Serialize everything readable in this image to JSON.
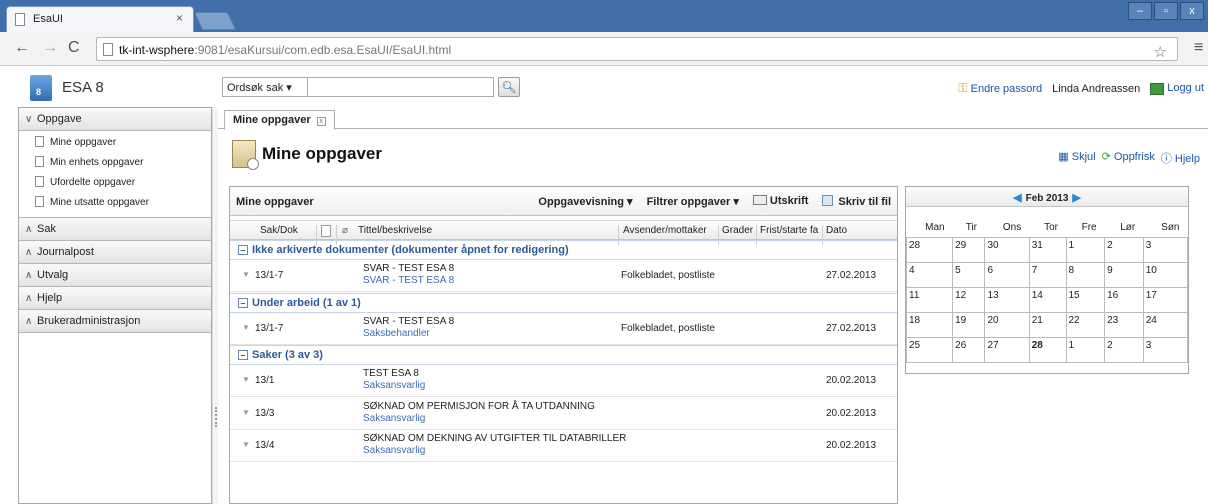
{
  "browser": {
    "tab_title": "EsaUI",
    "tab_close": "×",
    "url_host": "tk-int-wsphere",
    "url_rest": ":9081/esaKursui/com.edb.esa.EsaUI/EsaUI.html",
    "window_buttons": [
      "–",
      "▫",
      "x"
    ]
  },
  "app": {
    "name": "ESA 8",
    "logo_badge": "8",
    "search_mode": "Ordsøk sak ▾",
    "search_placeholder": "",
    "change_password": "Endre passord",
    "user_name": "Linda Andreassen",
    "logout": "Logg ut"
  },
  "sidebar": {
    "sections": [
      {
        "label": "Oppgave",
        "expanded": true,
        "items": [
          "Mine oppgaver",
          "Min enhets oppgaver",
          "Ufordelte oppgaver",
          "Mine utsatte oppgaver"
        ]
      },
      {
        "label": "Sak",
        "expanded": false
      },
      {
        "label": "Journalpost",
        "expanded": false
      },
      {
        "label": "Utvalg",
        "expanded": false
      },
      {
        "label": "Hjelp",
        "expanded": false
      },
      {
        "label": "Brukeradministrasjon",
        "expanded": false
      }
    ]
  },
  "main": {
    "tab_label": "Mine oppgaver",
    "page_title": "Mine oppgaver",
    "actions": {
      "hide": "Skjul",
      "refresh": "Oppfrisk",
      "help": "Hjelp"
    }
  },
  "panel": {
    "title": "Mine oppgaver",
    "tools": {
      "view": "Oppgavevisning ▾",
      "filter": "Filtrer oppgaver ▾",
      "print": "Utskrift",
      "write_file": "Skriv til fil"
    },
    "columns": [
      "Sak/Dok",
      "Tittel/beskrivelse",
      "Avsender/mottaker",
      "Grader",
      "Frist/starte fa",
      "Dato"
    ],
    "groups": [
      {
        "label": "Ikke arkiverte dokumenter (dokumenter åpnet for redigering)",
        "rows": [
          {
            "sak": "13/1-7",
            "title": "SVAR - TEST ESA 8",
            "sub": "SVAR - TEST ESA 8",
            "avs": "Folkebladet, postliste",
            "dato": "27.02.2013"
          }
        ]
      },
      {
        "label": "Under arbeid (1 av 1)",
        "rows": [
          {
            "sak": "13/1-7",
            "title": "SVAR - TEST ESA 8",
            "sub": "Saksbehandler",
            "avs": "Folkebladet, postliste",
            "dato": "27.02.2013"
          }
        ]
      },
      {
        "label": "Saker (3 av 3)",
        "rows": [
          {
            "sak": "13/1",
            "title": "TEST ESA 8",
            "sub": "Saksansvarlig",
            "avs": "",
            "dato": "20.02.2013"
          },
          {
            "sak": "13/3",
            "title": "SØKNAD OM PERMISJON FOR Å TA UTDANNING",
            "sub": "Saksansvarlig",
            "avs": "",
            "dato": "20.02.2013"
          },
          {
            "sak": "13/4",
            "title": "SØKNAD OM DEKNING AV UTGIFTER TIL DATABRILLER",
            "sub": "Saksansvarlig",
            "avs": "",
            "dato": "20.02.2013"
          }
        ]
      }
    ]
  },
  "calendar": {
    "month": "Feb 2013",
    "days": [
      "Man",
      "Tir",
      "Ons",
      "Tor",
      "Fre",
      "Lør",
      "Søn"
    ],
    "weeks": [
      [
        "28",
        "29",
        "30",
        "31",
        "1",
        "2",
        "3"
      ],
      [
        "4",
        "5",
        "6",
        "7",
        "8",
        "9",
        "10"
      ],
      [
        "11",
        "12",
        "13",
        "14",
        "15",
        "16",
        "17"
      ],
      [
        "18",
        "19",
        "20",
        "21",
        "22",
        "23",
        "24"
      ],
      [
        "25",
        "26",
        "27",
        "28",
        "1",
        "2",
        "3"
      ]
    ],
    "today": "28"
  },
  "colors": {
    "chrome_blue": "#3f6ea8",
    "link_blue": "#1a55a8",
    "group_blue": "#2a5a9a"
  }
}
